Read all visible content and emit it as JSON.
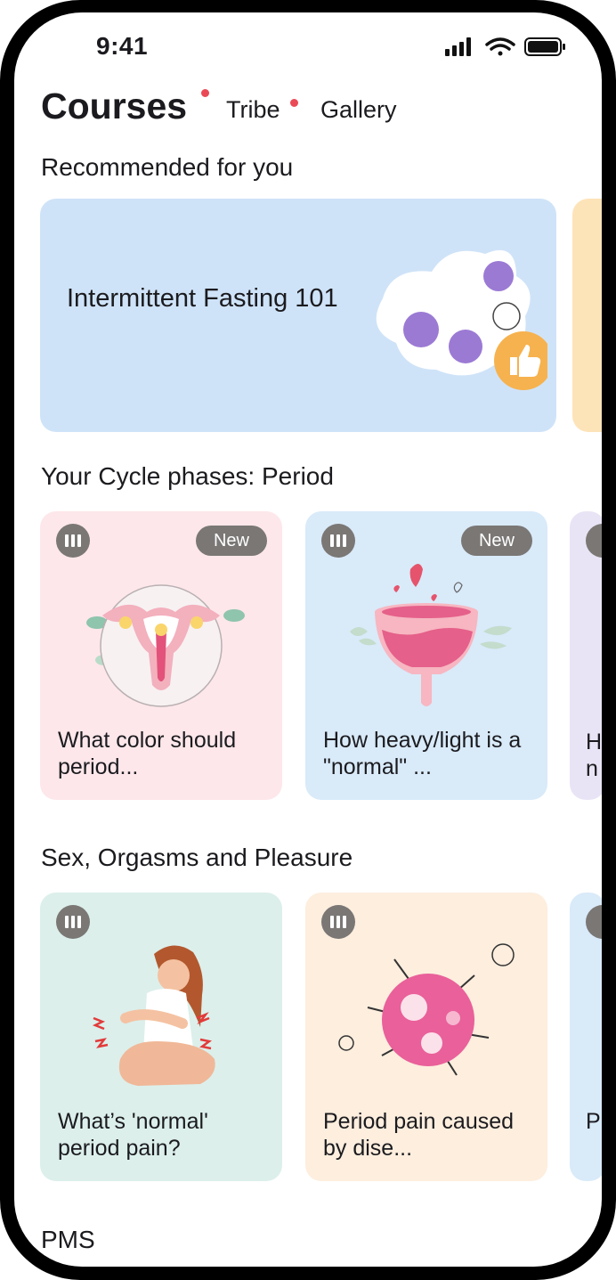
{
  "status_bar": {
    "time": "9:41"
  },
  "tabs": {
    "courses": "Courses",
    "tribe": "Tribe",
    "gallery": "Gallery"
  },
  "recommended": {
    "title": "Recommended for you",
    "card": {
      "title": "Intermittent Fasting 101"
    }
  },
  "cycle_section": {
    "title": "Your Cycle phases: Period",
    "cards": [
      {
        "title": "What color should period...",
        "badge": "New"
      },
      {
        "title": "How heavy/light is a \"normal\" ...",
        "badge": "New"
      }
    ],
    "peek_text": "H\nn"
  },
  "sex_section": {
    "title": "Sex, Orgasms and Pleasure",
    "cards": [
      {
        "title": "What’s 'normal' period pain?"
      },
      {
        "title": "Period pain caused by dise..."
      }
    ],
    "peek_text": "P"
  },
  "pms_section": {
    "title": "PMS"
  },
  "colors": {
    "accent_dot": "#ea4a55",
    "rec_card_bg": "#cfe3f8",
    "rec_peek_bg": "#fde3b8",
    "card_pink": "#fde7ea",
    "card_blue": "#d9eaf9",
    "card_lavender": "#e9e4f5",
    "card_mint": "#dcefeb",
    "card_peach": "#fdeede",
    "badge_gray": "#7a7775"
  },
  "icons": [
    "signal-icon",
    "wifi-icon",
    "battery-icon",
    "audio-course-icon",
    "thumbs-up-icon"
  ]
}
